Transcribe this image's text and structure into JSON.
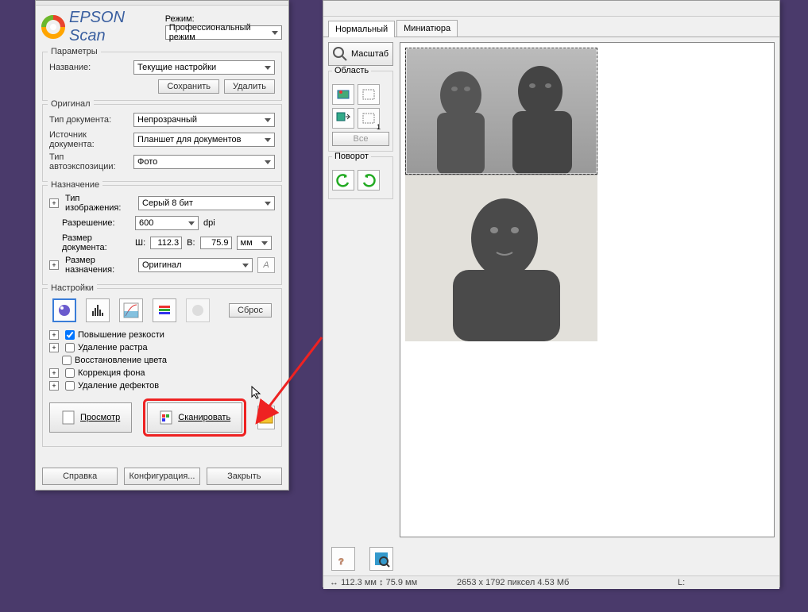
{
  "main": {
    "appName": "EPSON Scan",
    "modeLabel": "Режим:",
    "modeValue": "Профессиональный режим",
    "parameters": {
      "title": "Параметры",
      "nameLabel": "Название:",
      "nameValue": "Текущие настройки",
      "saveBtn": "Сохранить",
      "deleteBtn": "Удалить"
    },
    "original": {
      "title": "Оригинал",
      "docTypeLabel": "Тип документа:",
      "docTypeValue": "Непрозрачный",
      "sourceLabel": "Источник документа:",
      "sourceValue": "Планшет для документов",
      "autoExpLabel": "Тип автоэкспозиции:",
      "autoExpValue": "Фото"
    },
    "destination": {
      "title": "Назначение",
      "imageTypeLabel": "Тип изображения:",
      "imageTypeValue": "Серый 8 бит",
      "resolutionLabel": "Разрешение:",
      "resolutionValue": "600",
      "dpi": "dpi",
      "docSizeLabel": "Размер документа:",
      "wLbl": "Ш:",
      "wVal": "112.3",
      "hLbl": "В:",
      "hVal": "75.9",
      "unit": "мм",
      "targetSizeLabel": "Размер назначения:",
      "targetSizeValue": "Оригинал"
    },
    "adjust": {
      "title": "Настройки",
      "resetBtn": "Сброс",
      "sharpen": "Повышение резкости",
      "descreen": "Удаление растра",
      "colorRestore": "Восстановление цвета",
      "backlight": "Коррекция фона",
      "dustRemove": "Удаление дефектов"
    },
    "actions": {
      "preview": "Просмотр",
      "scan": "Сканировать",
      "help": "Справка",
      "config": "Конфигурация...",
      "close": "Закрыть"
    }
  },
  "preview": {
    "tabs": {
      "normal": "Нормальный",
      "thumb": "Миниатюра"
    },
    "zoom": "Масштаб",
    "area": {
      "title": "Область",
      "all": "Все",
      "count": "1"
    },
    "rotate": "Поворот",
    "status": {
      "dims": "112.3 мм",
      "dims2": "75.9 мм",
      "pixels": "2653 x 1792 пиксел 4.53 Мб",
      "L": "L:"
    }
  }
}
